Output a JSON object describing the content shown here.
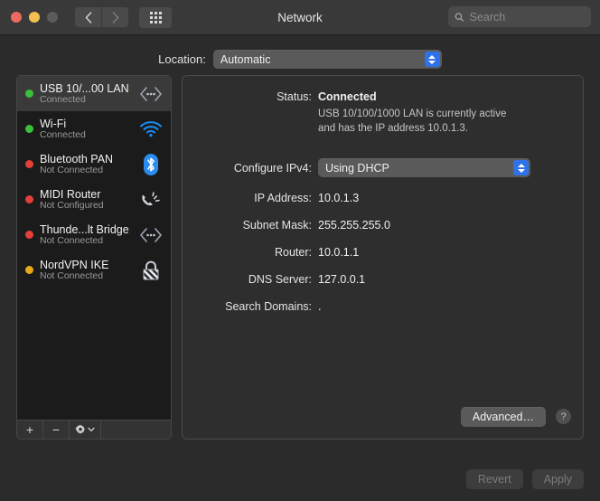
{
  "window": {
    "title": "Network",
    "traffic_lights": [
      "close",
      "minimize",
      "zoom"
    ],
    "back_label": "‹",
    "forward_label": "›"
  },
  "search": {
    "placeholder": "Search",
    "value": ""
  },
  "location": {
    "label": "Location:",
    "value": "Automatic"
  },
  "services": [
    {
      "name": "USB 10/...00 LAN",
      "status": "Connected",
      "dot": "green",
      "icon": "ethernet-icon",
      "selected": true
    },
    {
      "name": "Wi-Fi",
      "status": "Connected",
      "dot": "green",
      "icon": "wifi-icon",
      "selected": false
    },
    {
      "name": "Bluetooth PAN",
      "status": "Not Connected",
      "dot": "red",
      "icon": "bluetooth-icon",
      "selected": false
    },
    {
      "name": "MIDI Router",
      "status": "Not Configured",
      "dot": "red",
      "icon": "phone-ringing-icon",
      "selected": false
    },
    {
      "name": "Thunde...lt Bridge",
      "status": "Not Connected",
      "dot": "red",
      "icon": "ethernet-icon",
      "selected": false
    },
    {
      "name": "NordVPN IKE",
      "status": "Not Connected",
      "dot": "yellow",
      "icon": "lock-icon",
      "selected": false
    }
  ],
  "list_tools": {
    "add_label": "+",
    "remove_label": "−",
    "action_icon": "gear-icon"
  },
  "detail": {
    "status_label": "Status:",
    "status_value": "Connected",
    "status_description": "USB 10/100/1000 LAN is currently active and has the IP address 10.0.1.3.",
    "configure_ipv4_label": "Configure IPv4:",
    "configure_ipv4_value": "Using DHCP",
    "ip_address_label": "IP Address:",
    "ip_address_value": "10.0.1.3",
    "subnet_mask_label": "Subnet Mask:",
    "subnet_mask_value": "255.255.255.0",
    "router_label": "Router:",
    "router_value": "10.0.1.1",
    "dns_server_label": "DNS Server:",
    "dns_server_value": "127.0.0.1",
    "search_domains_label": "Search Domains:",
    "search_domains_value": ".",
    "advanced_label": "Advanced…",
    "help_label": "?"
  },
  "footer": {
    "revert_label": "Revert",
    "apply_label": "Apply"
  },
  "colors": {
    "accent_blue": "#2f71e8",
    "status_green": "#3ac03a",
    "status_red": "#e3403a",
    "status_yellow": "#e8a81d",
    "window_bg": "#2b2b2b",
    "titlebar_bg": "#393939",
    "list_bg": "#1b1b1b",
    "selected_row": "#3a3a3a"
  }
}
